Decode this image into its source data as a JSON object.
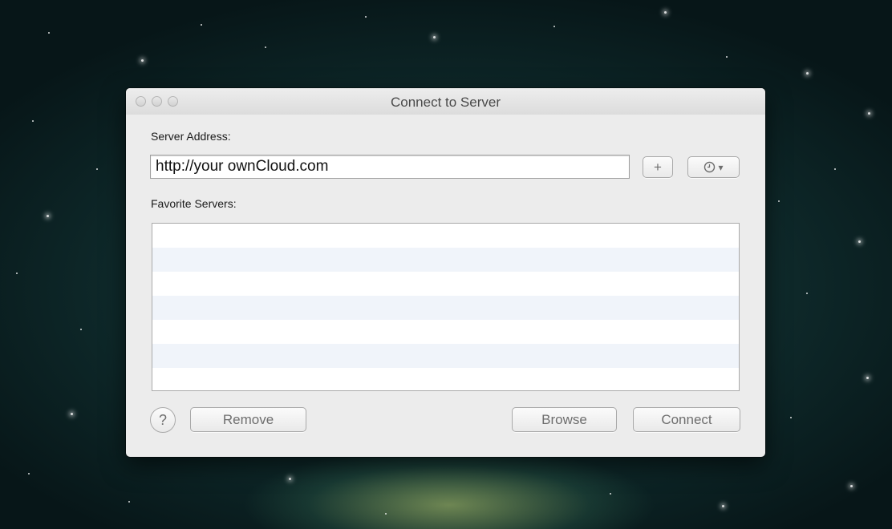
{
  "window": {
    "title": "Connect to Server"
  },
  "server_address": {
    "label": "Server Address:",
    "value": "http://your ownCloud.com"
  },
  "toolbar": {
    "add_label": "+",
    "recent_icon": "clock-icon",
    "recent_caret": "▾"
  },
  "favorites": {
    "label": "Favorite Servers:",
    "items": []
  },
  "buttons": {
    "help": "?",
    "remove": "Remove",
    "browse": "Browse",
    "connect": "Connect"
  }
}
